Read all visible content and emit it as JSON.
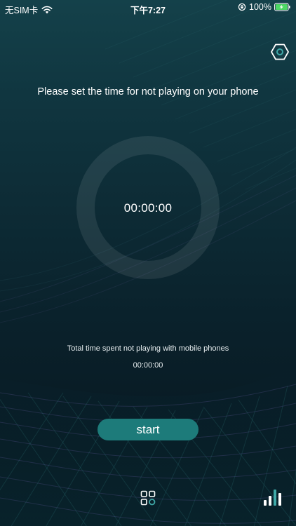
{
  "status_bar": {
    "carrier": "无SIM卡",
    "time": "下午7:27",
    "battery": "100%",
    "icons": [
      "wifi-icon",
      "rotation-lock-icon",
      "battery-charging-icon"
    ]
  },
  "header": {
    "settings_icon": "hexagon-settings-icon"
  },
  "main": {
    "prompt": "Please set the time for not playing on your phone",
    "timer_value": "00:00:00",
    "total_label": "Total time spent not playing with mobile phones",
    "total_value": "00:00:00",
    "start_label": "start"
  },
  "bottom_bar": {
    "left_icon": "grid-icon",
    "right_icon": "bar-chart-icon"
  },
  "colors": {
    "background_top": "#14414a",
    "background_bottom": "#07151d",
    "accent": "#1d7b7a",
    "icon_teal": "#3fa9a8"
  }
}
